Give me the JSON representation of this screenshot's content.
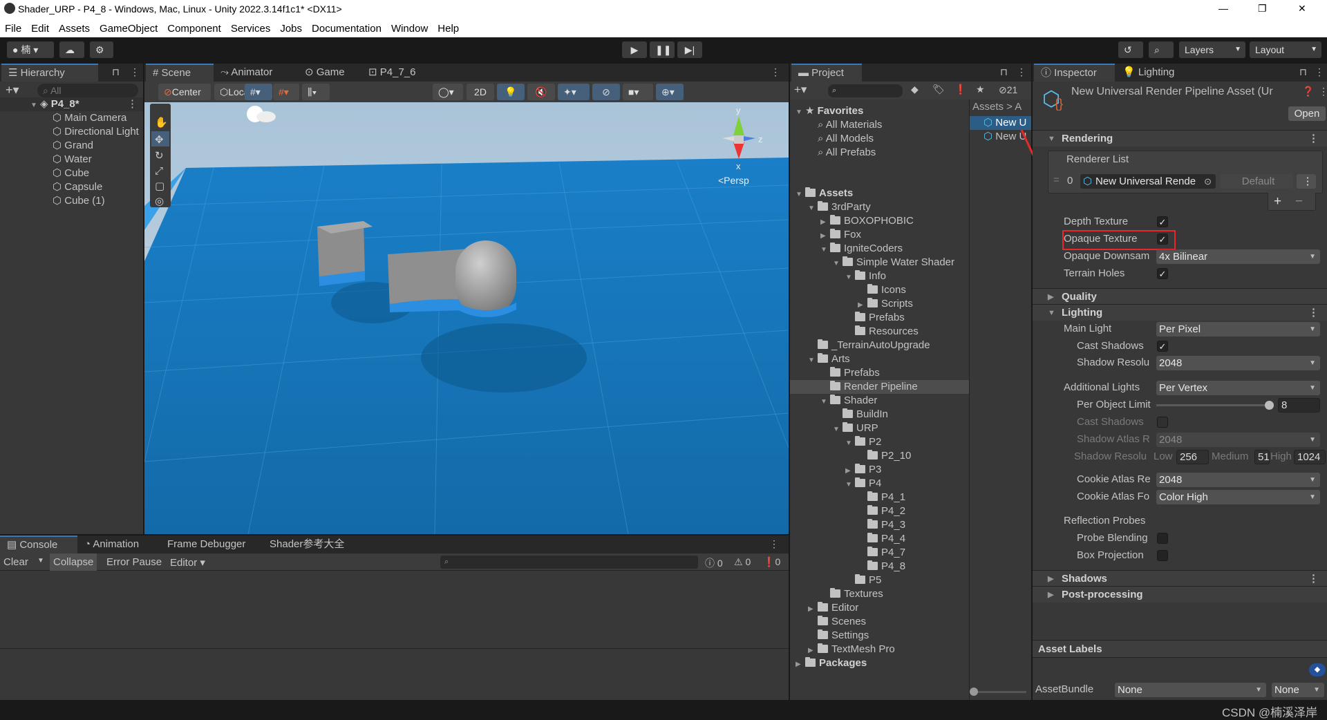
{
  "window": {
    "title": "Shader_URP - P4_8 - Windows, Mac, Linux - Unity 2022.3.14f1c1* <DX11>",
    "controls": [
      "—",
      "❐",
      "✕"
    ]
  },
  "menu": [
    "File",
    "Edit",
    "Assets",
    "GameObject",
    "Component",
    "Services",
    "Jobs",
    "Documentation",
    "Window",
    "Help"
  ],
  "toolbar": {
    "account": "楠",
    "layers": "Layers",
    "layout": "Layout"
  },
  "hierarchy": {
    "tab": "Hierarchy",
    "search_placeholder": "All",
    "scene": "P4_8*",
    "items": [
      "Main Camera",
      "Directional Light",
      "Grand",
      "Water",
      "Cube",
      "Capsule",
      "Cube (1)"
    ]
  },
  "scene_tabs": [
    "Scene",
    "Animator",
    "Game",
    "P4_7_6"
  ],
  "scene_toolbar": {
    "pivot": "Center",
    "space": "Local",
    "mode2d": "2D"
  },
  "gizmo": {
    "y": "y",
    "z": "z",
    "x": "x",
    "persp": "<Persp"
  },
  "console": {
    "tabs": [
      "Console",
      "Animation",
      "Frame Debugger",
      "Shader参考大全"
    ],
    "clear": "Clear",
    "collapse": "Collapse",
    "error_pause": "Error Pause",
    "editor": "Editor",
    "counts": [
      "0",
      "0",
      "0"
    ]
  },
  "project": {
    "tab": "Project",
    "hidden_count": "21",
    "breadcrumb": "Assets > A",
    "list": [
      "New U",
      "New U"
    ],
    "tree": [
      {
        "l": "Favorites",
        "d": 0,
        "a": "open",
        "i": "star",
        "b": true
      },
      {
        "l": "All Materials",
        "d": 1,
        "a": "",
        "i": "search"
      },
      {
        "l": "All Models",
        "d": 1,
        "a": "",
        "i": "search"
      },
      {
        "l": "All Prefabs",
        "d": 1,
        "a": "",
        "i": "search"
      },
      {
        "l": "",
        "d": 0,
        "a": "",
        "i": ""
      },
      {
        "l": "Assets",
        "d": 0,
        "a": "open",
        "i": "folder",
        "b": true
      },
      {
        "l": "3rdParty",
        "d": 1,
        "a": "open",
        "i": "folder"
      },
      {
        "l": "BOXOPHOBIC",
        "d": 2,
        "a": "closed",
        "i": "folder"
      },
      {
        "l": "Fox",
        "d": 2,
        "a": "closed",
        "i": "folder"
      },
      {
        "l": "IgniteCoders",
        "d": 2,
        "a": "open",
        "i": "folder"
      },
      {
        "l": "Simple Water Shader",
        "d": 3,
        "a": "open",
        "i": "folder"
      },
      {
        "l": "Info",
        "d": 4,
        "a": "open",
        "i": "folder"
      },
      {
        "l": "Icons",
        "d": 5,
        "a": "",
        "i": "folder"
      },
      {
        "l": "Scripts",
        "d": 5,
        "a": "closed",
        "i": "folder"
      },
      {
        "l": "Prefabs",
        "d": 4,
        "a": "",
        "i": "folder"
      },
      {
        "l": "Resources",
        "d": 4,
        "a": "",
        "i": "folder"
      },
      {
        "l": "_TerrainAutoUpgrade",
        "d": 1,
        "a": "",
        "i": "folder"
      },
      {
        "l": "Arts",
        "d": 1,
        "a": "open",
        "i": "folder"
      },
      {
        "l": "Prefabs",
        "d": 2,
        "a": "",
        "i": "folder"
      },
      {
        "l": "Render Pipeline",
        "d": 2,
        "a": "",
        "i": "folder",
        "s": true
      },
      {
        "l": "Shader",
        "d": 2,
        "a": "open",
        "i": "folder"
      },
      {
        "l": "BuildIn",
        "d": 3,
        "a": "",
        "i": "folder"
      },
      {
        "l": "URP",
        "d": 3,
        "a": "open",
        "i": "folder"
      },
      {
        "l": "P2",
        "d": 4,
        "a": "open",
        "i": "folder"
      },
      {
        "l": "P2_10",
        "d": 5,
        "a": "",
        "i": "folder"
      },
      {
        "l": "P3",
        "d": 4,
        "a": "closed",
        "i": "folder"
      },
      {
        "l": "P4",
        "d": 4,
        "a": "open",
        "i": "folder"
      },
      {
        "l": "P4_1",
        "d": 5,
        "a": "",
        "i": "folder"
      },
      {
        "l": "P4_2",
        "d": 5,
        "a": "",
        "i": "folder"
      },
      {
        "l": "P4_3",
        "d": 5,
        "a": "",
        "i": "folder"
      },
      {
        "l": "P4_4",
        "d": 5,
        "a": "",
        "i": "folder"
      },
      {
        "l": "P4_7",
        "d": 5,
        "a": "",
        "i": "folder"
      },
      {
        "l": "P4_8",
        "d": 5,
        "a": "",
        "i": "folder"
      },
      {
        "l": "P5",
        "d": 4,
        "a": "",
        "i": "folder"
      },
      {
        "l": "Textures",
        "d": 2,
        "a": "",
        "i": "folder"
      },
      {
        "l": "Editor",
        "d": 1,
        "a": "closed",
        "i": "folder"
      },
      {
        "l": "Scenes",
        "d": 1,
        "a": "",
        "i": "folder"
      },
      {
        "l": "Settings",
        "d": 1,
        "a": "",
        "i": "folder"
      },
      {
        "l": "TextMesh Pro",
        "d": 1,
        "a": "closed",
        "i": "folder"
      },
      {
        "l": "Packages",
        "d": 0,
        "a": "closed",
        "i": "folder",
        "b": true
      }
    ]
  },
  "inspector": {
    "tabs": [
      "Inspector",
      "Lighting"
    ],
    "asset_title": "New Universal Render Pipeline Asset (Ur",
    "open": "Open",
    "rendering": {
      "title": "Rendering",
      "renderer_list": "Renderer List",
      "index": "0",
      "renderer": "New Universal Rende",
      "default": "Default",
      "plus": "+",
      "minus": "−",
      "depth_texture": "Depth Texture",
      "depth_checked": true,
      "opaque_texture": "Opaque Texture",
      "opaque_checked": true,
      "opaque_downsampling": "Opaque Downsam",
      "opaque_downsampling_value": "4x Bilinear",
      "terrain_holes": "Terrain Holes",
      "terrain_checked": true
    },
    "quality": "Quality",
    "lighting": {
      "title": "Lighting",
      "main_light": "Main Light",
      "main_light_value": "Per Pixel",
      "cast_shadows": "Cast Shadows",
      "shadow_resolution": "Shadow Resolu",
      "shadow_resolution_value": "2048",
      "additional_lights": "Additional Lights",
      "additional_lights_value": "Per Vertex",
      "per_object_limit": "Per Object Limit",
      "per_object_limit_value": "8",
      "add_cast_shadows": "Cast Shadows",
      "shadow_atlas": "Shadow Atlas R",
      "shadow_atlas_value": "2048",
      "shadow_res_tiers": "Shadow Resolu",
      "low": "Low",
      "low_value": "256",
      "medium": "Medium",
      "medium_value": "51",
      "high": "High",
      "high_value": "1024",
      "cookie_atlas_res": "Cookie Atlas Re",
      "cookie_atlas_res_value": "2048",
      "cookie_atlas_format": "Cookie Atlas Fo",
      "cookie_atlas_format_value": "Color High",
      "reflection_probes": "Reflection Probes",
      "probe_blending": "Probe Blending",
      "box_projection": "Box Projection"
    },
    "shadows": "Shadows",
    "post_processing": "Post-processing",
    "asset_labels": "Asset Labels",
    "asset_bundle": "AssetBundle",
    "bundle_value": "None",
    "variant_value": "None"
  },
  "watermark": "CSDN @楠溪泽岸",
  "colors": {
    "accent": "#3a79bb",
    "selection": "#2c5d87",
    "annotation": "#e8282b"
  }
}
